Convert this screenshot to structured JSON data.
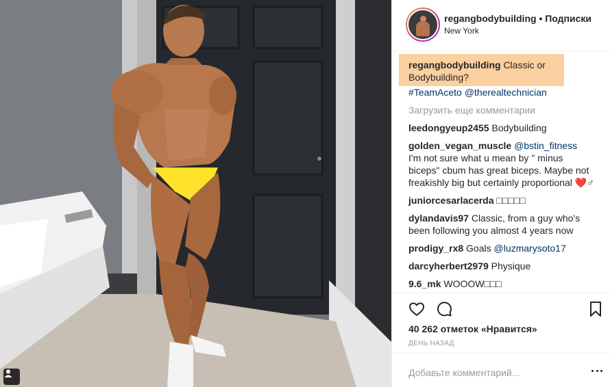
{
  "header": {
    "username": "regangbodybuilding",
    "separator": "•",
    "follow_label": "Подписки",
    "location": "New York"
  },
  "caption": {
    "username": "regangbodybuilding",
    "text": "Classic or Bodybuilding?",
    "hashtag": "#TeamAceto",
    "mention": "@therealtechnician"
  },
  "load_more": "Загрузить еще комментарии",
  "comments": [
    {
      "user": "leedongyeup2455",
      "text": "Bodybuilding"
    },
    {
      "user": "golden_vegan_muscle",
      "mention": "@bstin_fitness",
      "text": "I'm not sure what u mean by \" minus biceps\" cbum has great biceps. Maybe not freakishly big but certainly proportional ❤️♂"
    },
    {
      "user": "juniorcesarlacerda",
      "text": "□□□□□"
    },
    {
      "user": "dylandavis97",
      "text": "Classic, from a guy who's been following you almost 4 years now"
    },
    {
      "user": "prodigy_rx8",
      "text": "Goals",
      "mention": "@luzmarysoto17"
    },
    {
      "user": "darcyherbert2979",
      "text": "Physique"
    },
    {
      "user": "9.6_mk",
      "text": "WOOOW□□□"
    }
  ],
  "actions": {
    "like_icon": "heart-icon",
    "comment_icon": "comment-icon",
    "save_icon": "bookmark-icon"
  },
  "likes": "40 262 отметок «Нравится»",
  "time_ago": "день назад",
  "add_comment": {
    "placeholder": "Добавьте комментарий...",
    "more_icon": "more-icon"
  },
  "colors": {
    "highlight": "#fbcf9f",
    "link": "#003569",
    "muted": "#999999"
  }
}
